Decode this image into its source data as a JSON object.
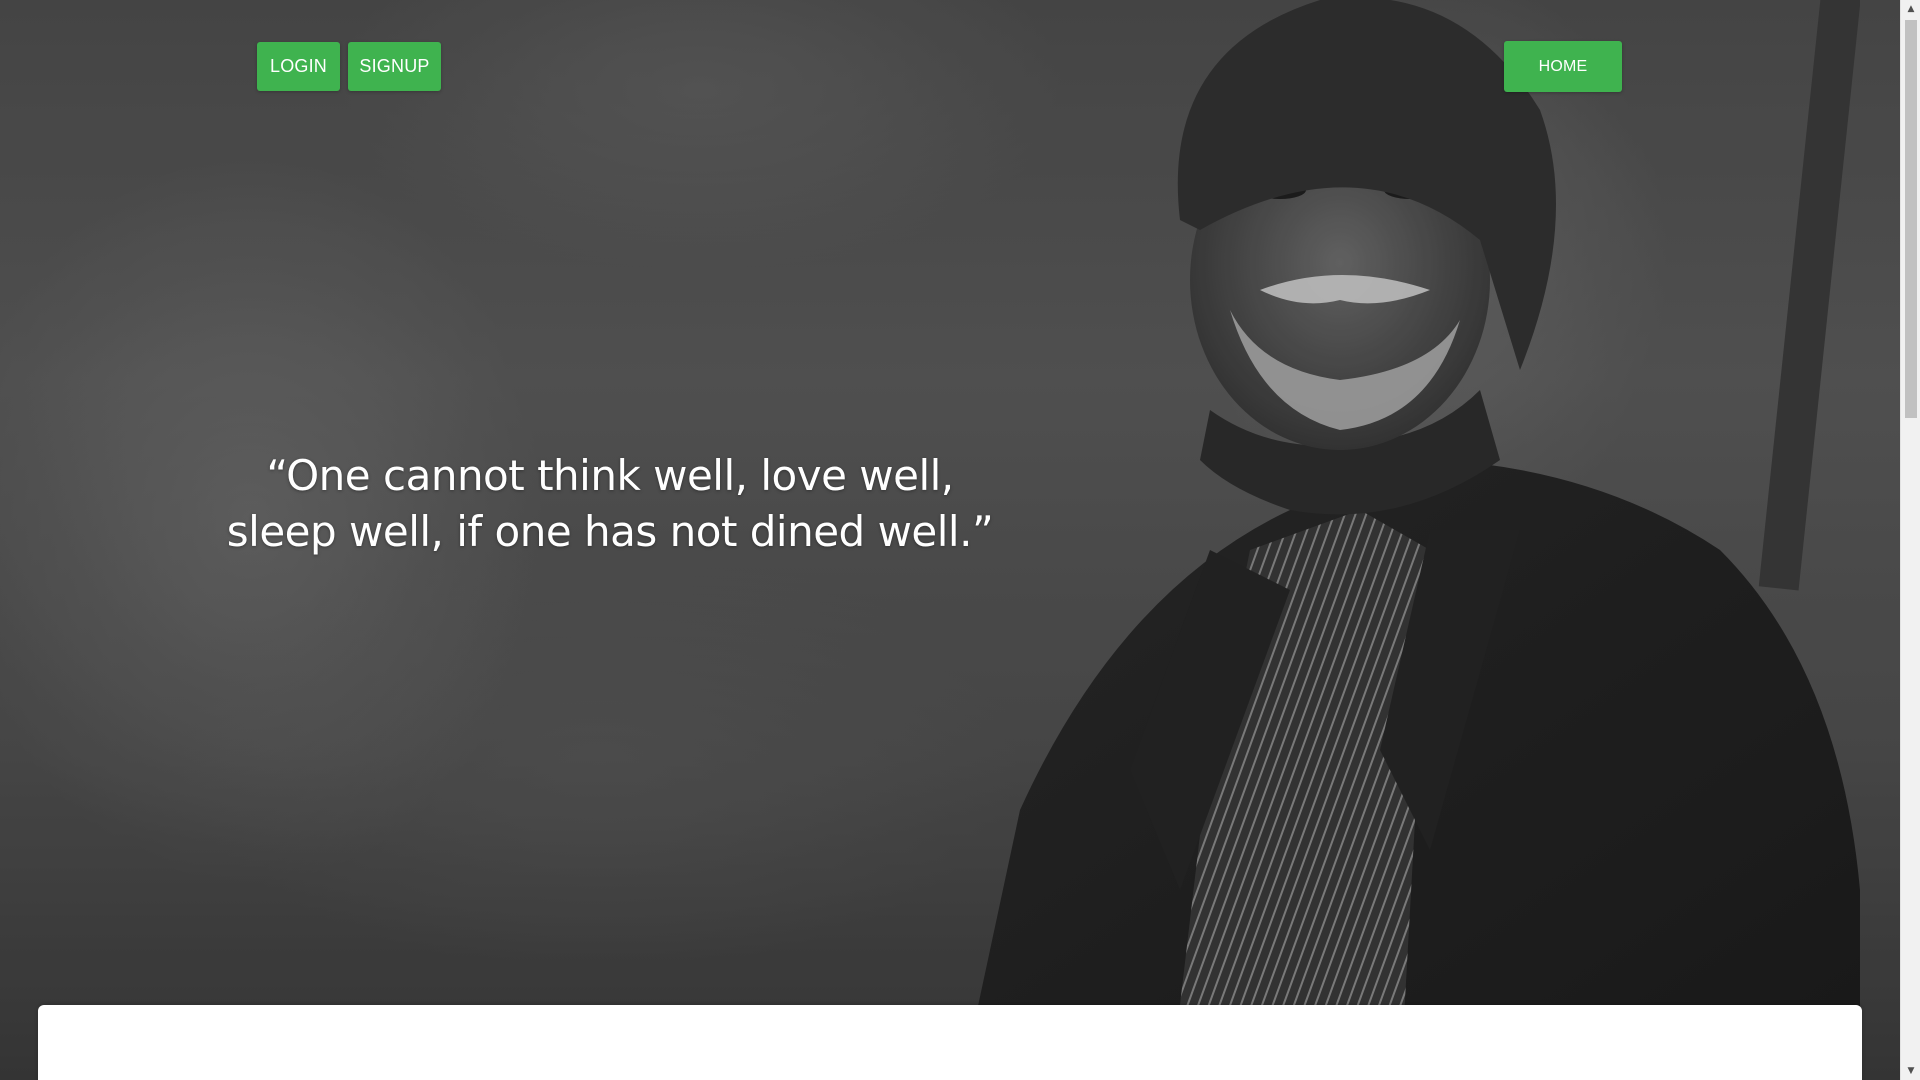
{
  "nav": {
    "login_label": "LOGIN",
    "signup_label": "SIGNUP",
    "home_label": "HOME"
  },
  "hero": {
    "quote_line1": "“One cannot think well, love well,",
    "quote_line2": "sleep well, if one has not dined well.”"
  },
  "colors": {
    "accent": "#3fb34f",
    "text_on_hero": "#ffffff",
    "card_background": "#ffffff"
  },
  "icons": {
    "scroll_up": "triangle-up-icon",
    "scroll_down": "triangle-down-icon"
  }
}
